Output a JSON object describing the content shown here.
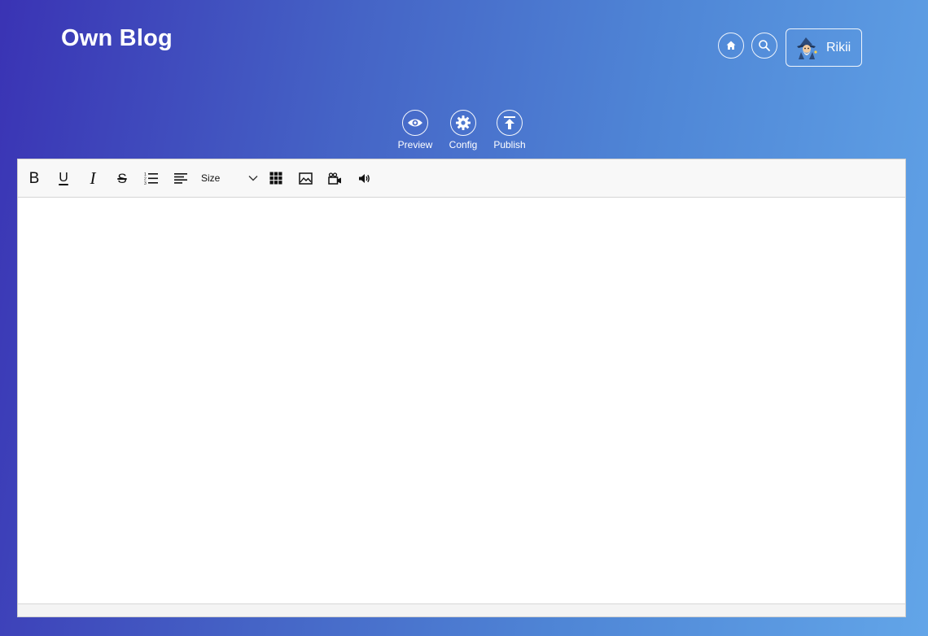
{
  "header": {
    "brand": "Own Blog",
    "icons": [
      "home-icon",
      "search-icon"
    ],
    "user": {
      "name": "Rikii",
      "avatar_icon": "wizard-avatar-icon"
    }
  },
  "actions": [
    {
      "label": "Preview",
      "icon": "eye-icon"
    },
    {
      "label": "Config",
      "icon": "gear-icon"
    },
    {
      "label": "Publish",
      "icon": "upload-icon"
    }
  ],
  "toolbar": {
    "bold": "B",
    "underline": "U",
    "italic": "I",
    "strike": "S",
    "size_value": "Size",
    "tools": [
      "bold-icon",
      "underline-icon",
      "italic-icon",
      "strikethrough-icon",
      "ordered-list-icon",
      "align-left-icon",
      "font-size-select",
      "table-icon",
      "image-icon",
      "video-icon",
      "audio-icon"
    ]
  },
  "editor": {
    "content": ""
  },
  "colors": {
    "gradient_start": "#3a33b4",
    "gradient_end": "#62a5e8",
    "toolbar_bg": "#f8f8f8",
    "editor_bg": "#ffffff"
  }
}
